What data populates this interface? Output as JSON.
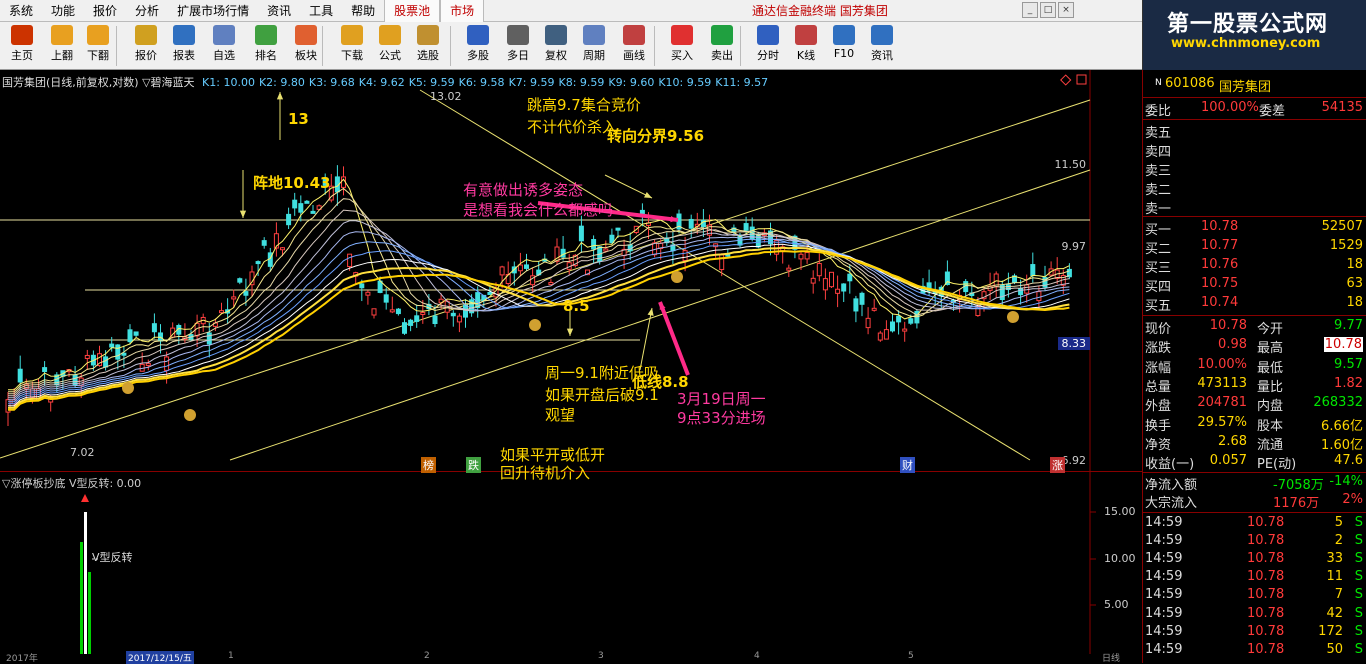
{
  "menu": {
    "items": [
      "系统",
      "功能",
      "报价",
      "分析",
      "扩展市场行情",
      "资讯",
      "工具",
      "帮助"
    ],
    "tabs": [
      "股票池",
      "市场"
    ],
    "app_title": "通达信金融终端  国芳集团"
  },
  "logo": {
    "title": "第一股票公式网",
    "url": "www.chnmoney.com"
  },
  "toolbar": {
    "buttons": [
      {
        "label": "主页",
        "icon": "home-icon",
        "color": "#cc3300"
      },
      {
        "label": "上翻",
        "icon": "arrow-up-icon",
        "color": "#e8a020"
      },
      {
        "label": "下翻",
        "icon": "arrow-down-icon",
        "color": "#e8a020"
      },
      {
        "label": "报价",
        "icon": "yen-icon",
        "color": "#d0a020"
      },
      {
        "label": "报表",
        "icon": "report-icon",
        "color": "#3070c0"
      },
      {
        "label": "自选",
        "icon": "f6-icon",
        "color": "#6080c0"
      },
      {
        "label": "排名",
        "icon": "rank-icon",
        "color": "#40a040"
      },
      {
        "label": "板块",
        "icon": "block-icon",
        "color": "#e06030"
      },
      {
        "label": "下载",
        "icon": "download-icon",
        "color": "#e0a020"
      },
      {
        "label": "公式",
        "icon": "formula-icon",
        "color": "#e0a020"
      },
      {
        "label": "选股",
        "icon": "stock-select-icon",
        "color": "#c09030"
      },
      {
        "label": "多股",
        "icon": "multi-stock-icon",
        "color": "#3060c0"
      },
      {
        "label": "多日",
        "icon": "multi-day-icon",
        "color": "#606060"
      },
      {
        "label": "复权",
        "icon": "restore-icon",
        "color": "#406080"
      },
      {
        "label": "周期",
        "icon": "f8-icon",
        "color": "#6080c0"
      },
      {
        "label": "画线",
        "icon": "draw-line-icon",
        "color": "#c04040"
      },
      {
        "label": "买入",
        "icon": "buy-icon",
        "color": "#e03030"
      },
      {
        "label": "卖出",
        "icon": "sell-icon",
        "color": "#20a040"
      },
      {
        "label": "分时",
        "icon": "intraday-icon",
        "color": "#3060c0"
      },
      {
        "label": "K线",
        "icon": "kline-icon",
        "color": "#c04040"
      },
      {
        "label": "F10",
        "icon": "f10-icon",
        "color": "#3070c0"
      },
      {
        "label": "资讯",
        "icon": "news-icon",
        "color": "#3070c0"
      }
    ]
  },
  "chart": {
    "info_name": "国芳集团(日线,前复权,对数)",
    "indicator": "▽碧海蓝天",
    "kvals": [
      "K1: 10.00",
      "K2: 9.80",
      "K3: 9.68",
      "K4: 9.62",
      "K5: 9.59",
      "K6: 9.58",
      "K7: 9.59",
      "K8: 9.59",
      "K9: 9.60",
      "K10: 9.59",
      "K11: 9.57"
    ],
    "price_labels": [
      "11.50",
      "9.97",
      "8.33",
      "6.92"
    ],
    "high_label": "13.02",
    "low_label": "7.02",
    "annotations": {
      "a13": "13",
      "zhendi": "阵地10.43",
      "tiaogao1": "跳高9.7集合竞价",
      "tiaogao2": "不计代价杀入",
      "zhuanxiang": "转向分界9.56",
      "youyi1": "有意做出诱多姿态",
      "youyi2": "是想看我会什么都感吗",
      "p85": "8.5",
      "zhouyi1": "周一9.1附近低吸",
      "zhouyi2": "如果开盘后破9.1",
      "zhouyi3": "观望",
      "ruguo1": "如果平开或低开",
      "ruguo2": "回升待机介入",
      "dixian": "低线8.8",
      "march1": "3月19日周一",
      "march2": "9点33分进场"
    },
    "markers": [
      "榜",
      "跌",
      "财",
      "涨"
    ]
  },
  "subchart": {
    "info": "▽涨停板抄底  V型反转: 0.00",
    "label": "V型反转",
    "levels": [
      "15.00",
      "10.00",
      "5.00"
    ]
  },
  "datebar": {
    "labels": [
      "2017年",
      "2017/12/15/五",
      "1",
      "2",
      "3",
      "4",
      "5",
      "日线"
    ]
  },
  "quote": {
    "code": "601086",
    "name": "国芳集团",
    "weibi_label": "委比",
    "weibi": "100.00%",
    "weicha_label": "委差",
    "weicha": "54135",
    "sells": [
      {
        "label": "卖五"
      },
      {
        "label": "卖四"
      },
      {
        "label": "卖三"
      },
      {
        "label": "卖二"
      },
      {
        "label": "卖一"
      }
    ],
    "buys": [
      {
        "label": "买一",
        "price": "10.78",
        "vol": "52507"
      },
      {
        "label": "买二",
        "price": "10.77",
        "vol": "1529"
      },
      {
        "label": "买三",
        "price": "10.76",
        "vol": "18"
      },
      {
        "label": "买四",
        "price": "10.75",
        "vol": "63"
      },
      {
        "label": "买五",
        "price": "10.74",
        "vol": "18"
      }
    ],
    "stats": [
      {
        "l1": "现价",
        "v1": "10.78",
        "l2": "今开",
        "v2": "9.77"
      },
      {
        "l1": "涨跌",
        "v1": "0.98",
        "l2": "最高",
        "v2": "10.78"
      },
      {
        "l1": "涨幅",
        "v1": "10.00%",
        "l2": "最低",
        "v2": "9.57"
      },
      {
        "l1": "总量",
        "v1": "473113",
        "l2": "量比",
        "v2": "1.82"
      },
      {
        "l1": "外盘",
        "v1": "204781",
        "l2": "内盘",
        "v2": "268332"
      },
      {
        "l1": "换手",
        "v1": "29.57%",
        "l2": "股本",
        "v2": "6.66亿"
      },
      {
        "l1": "净资",
        "v1": "2.68",
        "l2": "流通",
        "v2": "1.60亿"
      },
      {
        "l1": "收益(一)",
        "v1": "0.057",
        "l2": "PE(动)",
        "v2": "47.6"
      }
    ],
    "netflow_label": "净流入额",
    "netflow": "-7058万",
    "netflow_pct": "-14%",
    "bigflow_label": "大宗流入",
    "bigflow": "1176万",
    "bigflow_pct": "2%",
    "ticks": [
      {
        "t": "14:59",
        "p": "10.78",
        "v": "5",
        "d": "S"
      },
      {
        "t": "14:59",
        "p": "10.78",
        "v": "2",
        "d": "S"
      },
      {
        "t": "14:59",
        "p": "10.78",
        "v": "33",
        "d": "S"
      },
      {
        "t": "14:59",
        "p": "10.78",
        "v": "11",
        "d": "S"
      },
      {
        "t": "14:59",
        "p": "10.78",
        "v": "7",
        "d": "S"
      },
      {
        "t": "14:59",
        "p": "10.78",
        "v": "42",
        "d": "S"
      },
      {
        "t": "14:59",
        "p": "10.78",
        "v": "172",
        "d": "S"
      },
      {
        "t": "14:59",
        "p": "10.78",
        "v": "50",
        "d": "S"
      }
    ]
  }
}
